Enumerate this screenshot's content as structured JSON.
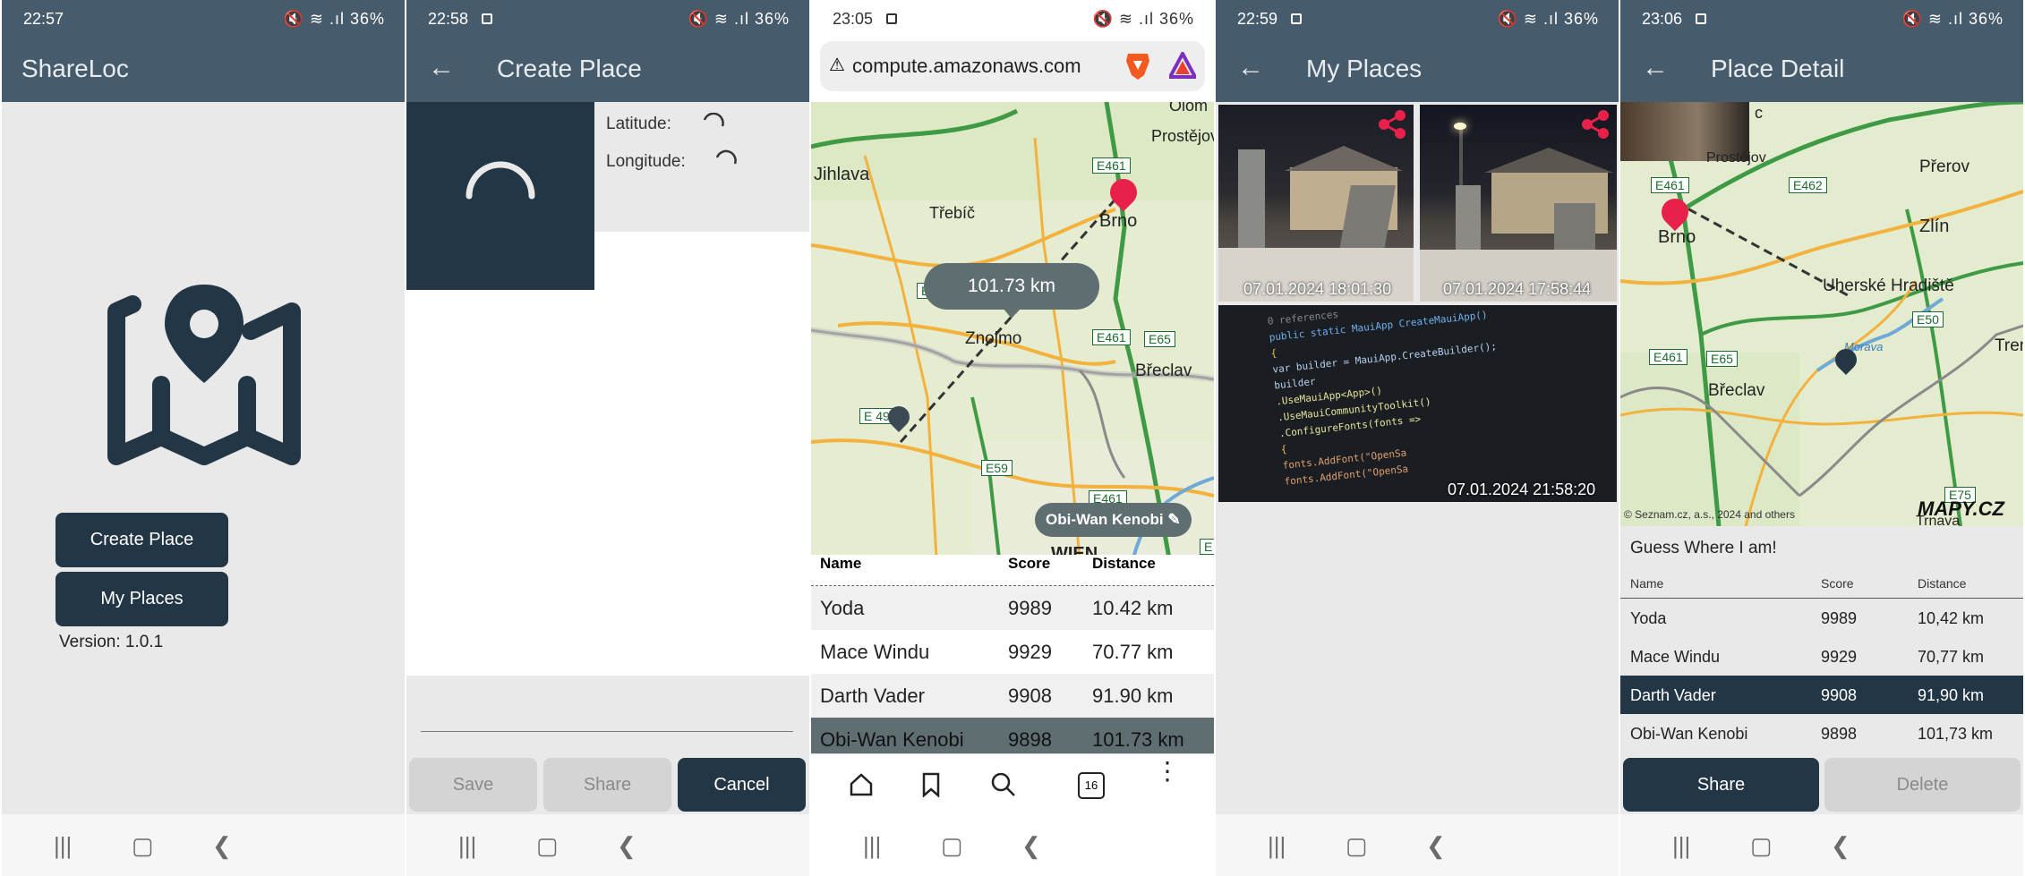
{
  "status_icons": "🔇 ≋ .ıl 36%",
  "screens": {
    "home": {
      "time": "22:57",
      "title": "ShareLoc",
      "create_label": "Create Place",
      "places_label": "My Places",
      "version": "Version: 1.0.1"
    },
    "create": {
      "time": "22:58",
      "title": "Create Place",
      "lat_label": "Latitude:",
      "lon_label": "Longitude:",
      "save_label": "Save",
      "share_label": "Share",
      "cancel_label": "Cancel"
    },
    "browser": {
      "time": "23:05",
      "url": "compute.amazonaws.com",
      "distance_bubble": "101.73 km",
      "player_chip": "Obi-Wan Kenobi",
      "tab_count": "16",
      "map_labels": {
        "jihlava": "Jihlava",
        "trebic": "Třebíč",
        "brno": "Brno",
        "znojmo": "Znojmo",
        "breclav": "Břeclav",
        "prostejov": "Prostějov",
        "olom": "Olom",
        "wien": "WIEN",
        "e461a": "E461",
        "e461b": "E461",
        "e461c": "E461",
        "e65": "E65",
        "e49": "E 49",
        "e59": "E59",
        "e_a": "E",
        "e_b": "E"
      },
      "columns": [
        "Name",
        "Score",
        "Distance"
      ],
      "rows": [
        {
          "name": "Yoda",
          "score": "9989",
          "distance": "10.42 km"
        },
        {
          "name": "Mace Windu",
          "score": "9929",
          "distance": "70.77 km"
        },
        {
          "name": "Darth Vader",
          "score": "9908",
          "distance": "91.90 km"
        },
        {
          "name": "Obi-Wan Kenobi",
          "score": "9898",
          "distance": "101.73 km"
        }
      ]
    },
    "places": {
      "time": "22:59",
      "title": "My Places",
      "photo1_date": "07.01.2024 18:01:30",
      "photo2_date": "07.01.2024 17:58:44",
      "photo3_date": "07.01.2024 21:58:20",
      "code_lines": [
        "0 references",
        "public static MauiApp CreateMauiApp()",
        "{",
        "    var builder = MauiApp.CreateBuilder();",
        "    builder",
        "      .UseMauiApp<App>()",
        "      .UseMauiCommunityToolkit()",
        "      .ConfigureFonts(fonts =>",
        "      {",
        "          fonts.AddFont(\"OpenSa",
        "          fonts.AddFont(\"OpenSa"
      ]
    },
    "detail": {
      "time": "23:06",
      "title": "Place Detail",
      "map_labels": {
        "prerov": "Přerov",
        "zlin": "Zlín",
        "brno": "Brno",
        "uh": "Uherské Hradiště",
        "breclav": "Břeclav",
        "tren": "Tren",
        "prostejov": "Prostějov",
        "morava": "Morava",
        "trnava": "Trnava",
        "c": "c",
        "e461a": "E461",
        "e462": "E462",
        "e50": "E50",
        "e461b": "E461",
        "e65": "E65",
        "e75": "E75"
      },
      "copyright": "© Seznam.cz, a.s., 2024 and others",
      "mapy_logo": "MAPY.CZ",
      "guess": "Guess Where I am!",
      "columns": [
        "Name",
        "Score",
        "Distance"
      ],
      "rows": [
        {
          "name": "Yoda",
          "score": "9989",
          "distance": "10,42 km"
        },
        {
          "name": "Mace Windu",
          "score": "9929",
          "distance": "70,77 km"
        },
        {
          "name": "Darth Vader",
          "score": "9908",
          "distance": "91,90 km"
        },
        {
          "name": "Obi-Wan Kenobi",
          "score": "9898",
          "distance": "101,73 km"
        }
      ],
      "share_label": "Share",
      "delete_label": "Delete"
    }
  }
}
